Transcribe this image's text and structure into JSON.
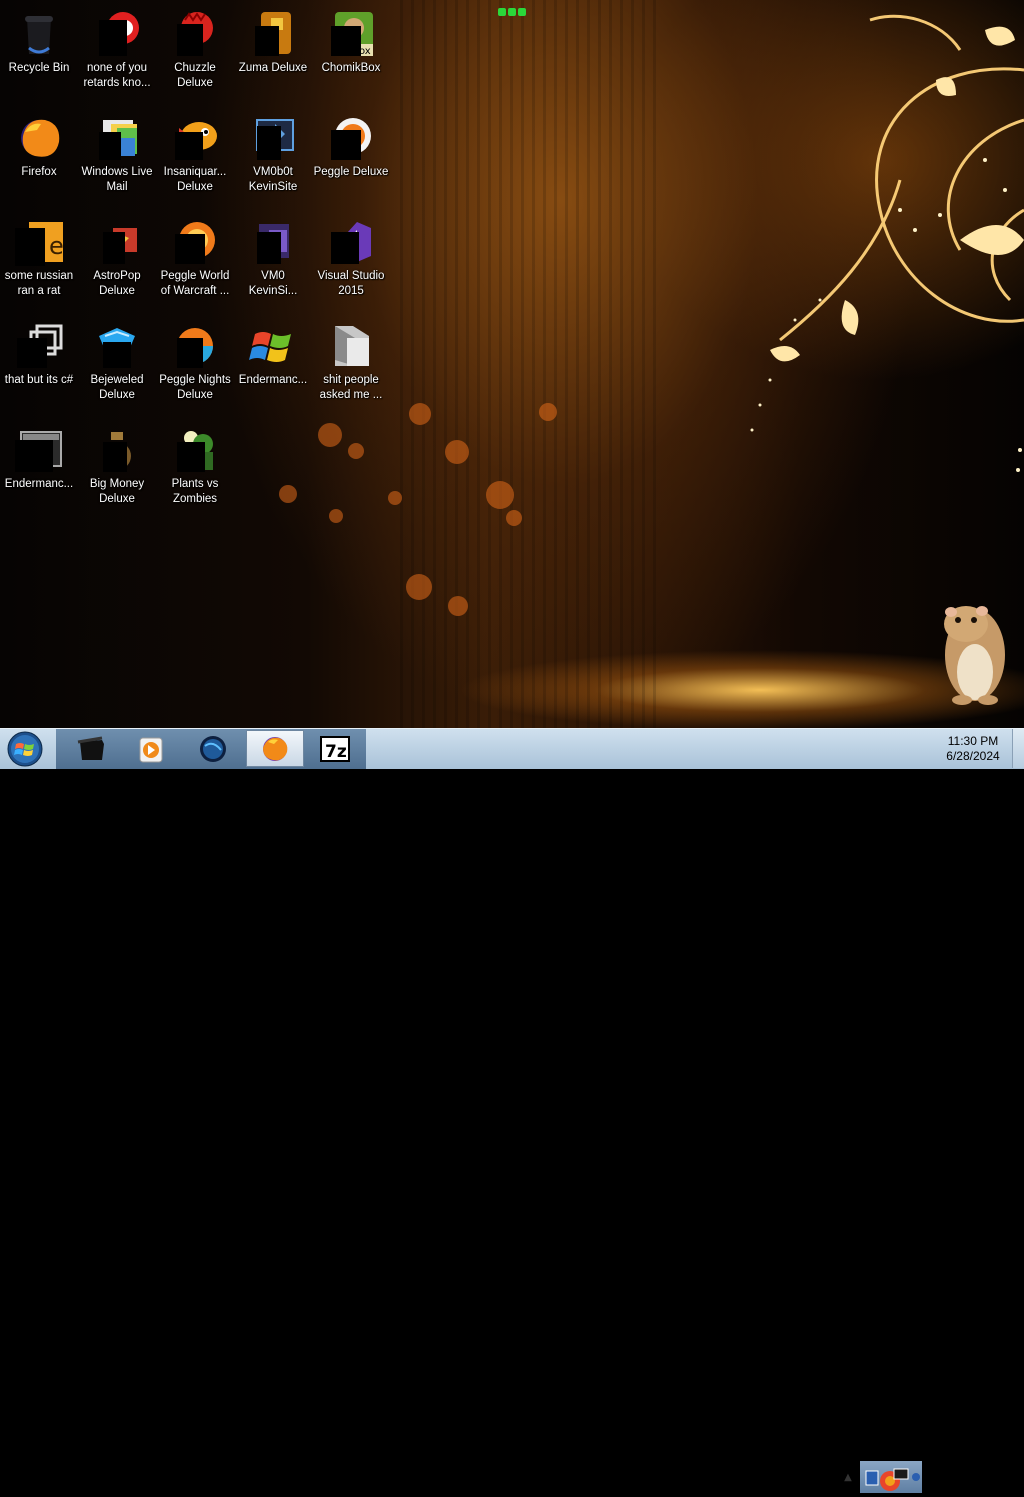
{
  "desktop": {
    "icons": [
      {
        "label": "Recycle Bin"
      },
      {
        "label": "none of you\nretards kno..."
      },
      {
        "label": "Chuzzle\nDeluxe"
      },
      {
        "label": "Zuma Deluxe"
      },
      {
        "label": "ChomikBox"
      },
      {
        "label": "Firefox"
      },
      {
        "label": "Windows Live\nMail"
      },
      {
        "label": "Insaniquar...\nDeluxe"
      },
      {
        "label": "VM0b0t\nKevinSite"
      },
      {
        "label": "Peggle Deluxe"
      },
      {
        "label": "some russian\nran a rat"
      },
      {
        "label": "AstroPop\nDeluxe"
      },
      {
        "label": "Peggle World\nof Warcraft ..."
      },
      {
        "label": "VM0\nKevinSi..."
      },
      {
        "label": "Visual Studio\n2015"
      },
      {
        "label": "that but its c#"
      },
      {
        "label": "Bejeweled\nDeluxe"
      },
      {
        "label": "Peggle Nights\nDeluxe"
      },
      {
        "label": "Endermanc..."
      },
      {
        "label": "shit people\nasked me ..."
      },
      {
        "label": "Endermanc..."
      },
      {
        "label": "Big Money\nDeluxe"
      },
      {
        "label": "Plants vs\nZombies"
      }
    ]
  },
  "taskbar": {
    "clock": {
      "time": "11:30 PM",
      "date": "6/28/2024"
    }
  },
  "colors": {
    "taskbar": "#a9c2d8",
    "accent_orange": "#f5b43a"
  }
}
